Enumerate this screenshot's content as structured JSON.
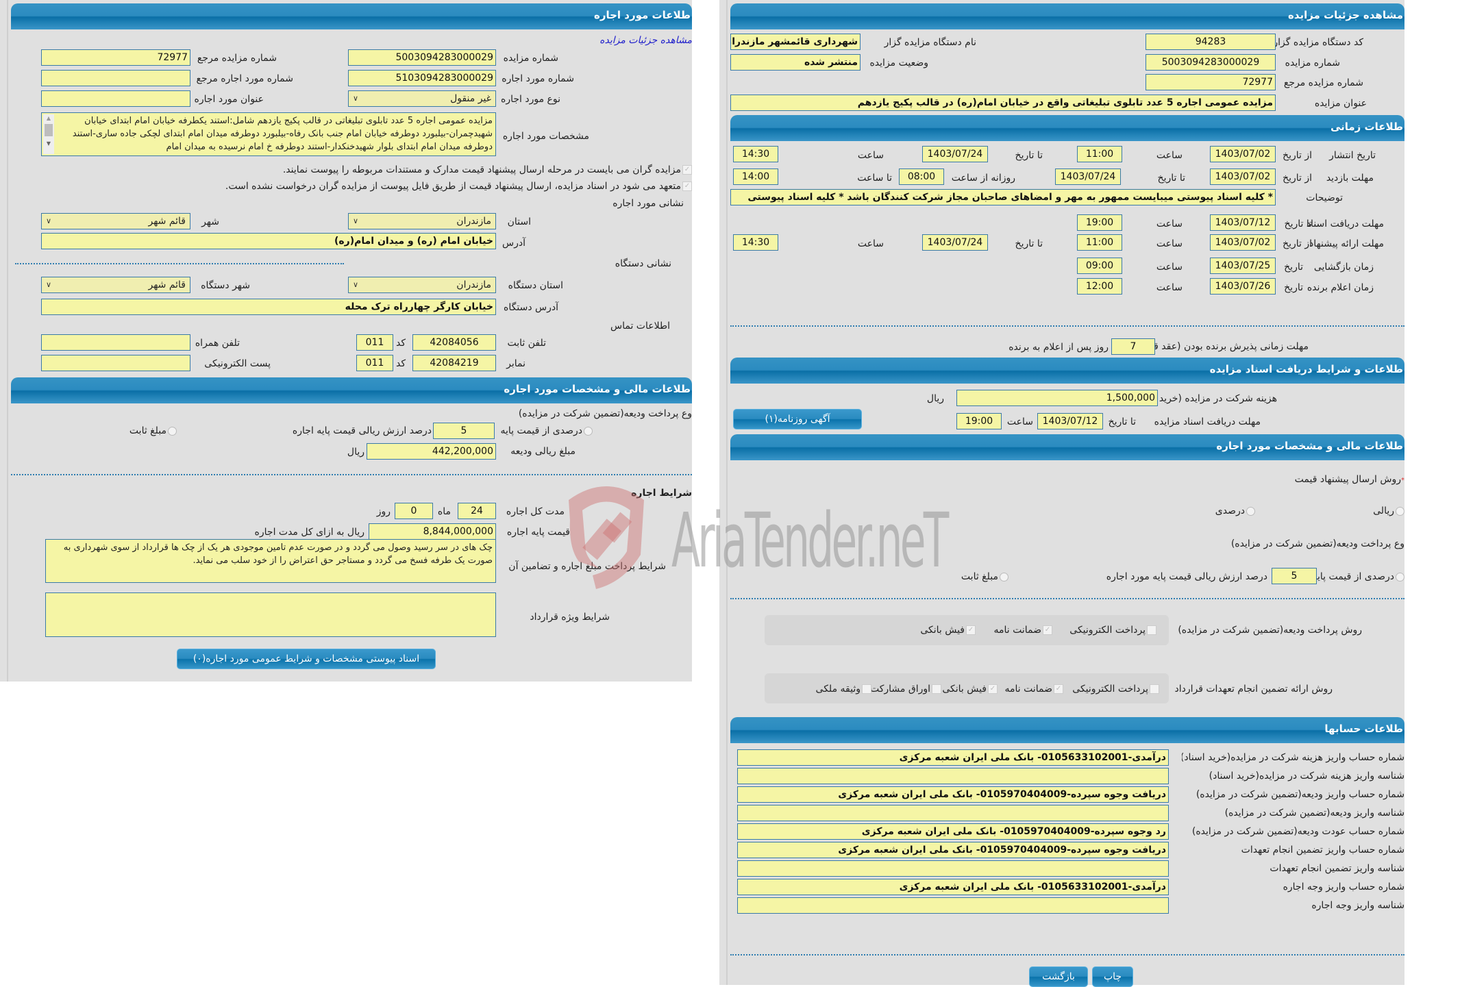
{
  "left": {
    "header": "طلاعات مورد اجاره",
    "view_details_link": "مشاهده جزئیات مزایده",
    "auction_number_label": "شماره مزایده",
    "auction_number": "5003094283000029",
    "ref_auction_number_label": "شماره مزایده مرجع",
    "ref_auction_number": "72977",
    "lease_item_number_label": "شماره مورد اجاره",
    "lease_item_number": "5103094283000029",
    "ref_lease_item_number_label": "شماره مورد اجاره مرجع",
    "ref_lease_item_number": "",
    "lease_type_label": "نوع مورد اجاره",
    "lease_type": "غیر منقول",
    "lease_title_label": "عنوان مورد اجاره",
    "lease_title": "",
    "specs_label": "مشخصات مورد اجاره",
    "specs": "مزایده عمومی اجاره 5 عدد تابلوی تبلیغاتی در قالب پکیج یازدهم شامل:استند یکطرفه خیابان امام ابتدای خیابان شهیدچمران-بیلبورد دوطرفه خیابان امام جنب بانک رفاه-بیلبورد دوطرفه میدان امام ابتدای لچکی جاده ساری-استند دوطرفه میدان امام ابتدای بلوار شهیدخنکدار-استند دوطرفه خ امام نرسیده به میدان امام",
    "check1": "مزایده گران می بایست در مرحله ارسال پیشنهاد قیمت مدارک و مستندات مربوطه را پیوست نمایند.",
    "check2": "متعهد می شود در اسناد مزایده، ارسال پیشنهاد قیمت از طریق فایل پیوست از مزایده گران درخواست نشده است.",
    "lease_address_title": "نشانی مورد اجاره",
    "province_label": "استان",
    "province": "مازندران",
    "city_label": "شهر",
    "city": "قائم شهر",
    "address_label": "آدرس",
    "address": "خیابان امام (ره) و میدان امام(ره)",
    "org_address_title": "نشانی دستگاه",
    "org_province_label": "استان دستگاه",
    "org_province": "مازندران",
    "org_city_label": "شهر دستگاه",
    "org_city": "قائم شهر",
    "org_address_label": "آدرس دستگاه",
    "org_address": "خیابان کارگر چهارراه ترک محله",
    "contact_title": "اطلاعات تماس",
    "phone_label": "تلفن ثابت",
    "phone": "42084056",
    "code_label": "کد",
    "phone_code": "011",
    "mobile_label": "تلفن همراه",
    "mobile": "",
    "fax_label": "نمابر",
    "fax": "42084219",
    "fax_code": "011",
    "email_label": "پست الکترونیکی",
    "email": "",
    "fin_header": "طلاعات مالی و مشخصات مورد اجاره",
    "deposit_type_label": "وع پرداخت ودیعه(تضمین شرکت در مزایده)",
    "percent_of_base_label": "درصدی از قیمت پایه",
    "percent_value": "5",
    "percent_suffix": "درصد ارزش ریالی قیمت پایه اجاره",
    "fixed_amount_label": "مبلغ ثابت",
    "deposit_amount_label": "مبلغ ریالی ودیعه",
    "deposit_amount": "442,200,000",
    "rial": "ریال",
    "lease_terms_title": "شرایط اجاره",
    "duration_label": "مدت کل اجاره",
    "duration_months": "24",
    "month_label": "ماه",
    "duration_days": "0",
    "day_label": "روز",
    "base_price_label": "قیمت پایه اجاره",
    "base_price": "8,844,000,000",
    "base_price_suffix": "ریال به ازای کل مدت اجاره",
    "payment_terms_label": "شرایط پرداخت مبلغ اجاره و تضامین آن",
    "payment_terms": "چک های در سر رسید وصول می گردد  و در صورت عدم تامین موجودی هر یک از چک ها قرارداد از سوی شهرداری به صورت یک طرفه فسخ می گردد و مستاجر حق اعتراض را از خود سلب می نماید.",
    "special_terms_label": "شرایط ویژه قرارداد",
    "special_terms": "",
    "attachments_button": "اسناد پیوستی مشخصات و شرایط عمومی مورد اجاره(۰)"
  },
  "right": {
    "header": "مشاهده جزئیات مزایده",
    "org_code_label": "کد دستگاه مزایده گزار",
    "org_code": "94283",
    "org_name_label": "نام دستگاه مزایده گزار",
    "org_name": "شهرداری قائمشهر مازندران",
    "auction_number_label": "شماره مزایده",
    "auction_number": "5003094283000029",
    "status_label": "وضعیت مزایده",
    "status": "منتشر شده",
    "ref_number_label": "شماره مزایده مرجع",
    "ref_number": "72977",
    "title_label": "عنوان مزایده",
    "title": "مزایده عمومی اجاره 5 عدد تابلوی تبلیغاتی واقع در خیابان امام(ره) در قالب پکیج یازدهم",
    "timing_header": "طلاعات زمانی",
    "publish_label": "تاریخ انتشار",
    "from_date_label": "از تاریخ",
    "to_date_label": "تا تاریخ",
    "date_label": "تاریخ",
    "time_label": "ساعت",
    "until_time_label": "تا ساعت",
    "daily_from_label": "روزانه از ساعت",
    "publish_from_date": "1403/07/02",
    "publish_from_time": "11:00",
    "publish_to_date": "1403/07/24",
    "publish_to_time": "14:30",
    "visit_label": "مهلت بازدید",
    "visit_from_date": "1403/07/02",
    "visit_to_date": "1403/07/24",
    "visit_daily_from": "08:00",
    "visit_daily_to": "14:00",
    "notes_label": "توضیحات",
    "notes": "*  کلیه اسناد پیوستی میبایست ممهور به مهر و امضاهای صاحبان مجاز شرکت کنندگان باشد * کلیه اسناد پیوستی",
    "doc_deadline_label": "مهلت دریافت اسناد",
    "doc_deadline_date": "1403/07/12",
    "doc_deadline_time": "19:00",
    "offer_label": "مهلت ارائه پیشنهاد",
    "offer_from_date": "1403/07/02",
    "offer_from_time": "11:00",
    "offer_to_date": "1403/07/24",
    "offer_to_time": "14:30",
    "opening_label": "زمان بازگشایی",
    "opening_date": "1403/07/25",
    "opening_time": "09:00",
    "winner_label": "زمان اعلام برنده",
    "winner_date": "1403/07/26",
    "winner_time": "12:00",
    "acceptance_label": "مهلت زمانی پذیرش برنده بودن (عقد قرارداد)",
    "acceptance_days": "7",
    "acceptance_suffix": "روز پس از اعلام به برنده",
    "docs_header": "طلاعات و شرایط دریافت اسناد مزایده",
    "fee_label": "هزینه شرکت در مزایده (خرید اسناد)",
    "fee": "1,500,000",
    "rial": "ریال",
    "docs_deadline_label": "مهلت دریافت اسناد مزایده",
    "docs_deadline_date": "1403/07/12",
    "docs_deadline_time": "19:00",
    "newspaper_button": "آگهی روزنامه(۱)",
    "fin_header": "طلاعات مالی و مشخصات مورد اجاره",
    "price_method_label": "روش ارسال پیشنهاد قیمت",
    "rial_option": "ریالی",
    "percent_option": "درصدی",
    "deposit_type_label": "وع پرداخت ودیعه(تضمین شرکت در مزایده)",
    "percent_of_base_label": "درصدی از قیمت پایه",
    "percent_value": "5",
    "percent_suffix": "درصد ارزش ریالی قیمت پایه مورد اجاره",
    "fixed_amount_label": "مبلغ ثابت",
    "deposit_method_label": "روش پرداخت ودیعه(تضمین شرکت در مزایده)",
    "deposit_methods": [
      {
        "label": "پرداخت الکترونیکی",
        "checked": false
      },
      {
        "label": "ضمانت نامه",
        "checked": true
      },
      {
        "label": "فیش بانکی",
        "checked": true
      }
    ],
    "guarantee_method_label": "روش ارائه تضمین انجام تعهدات قرارداد",
    "guarantee_methods": [
      {
        "label": "پرداخت الکترونیکی",
        "checked": false
      },
      {
        "label": "ضمانت نامه",
        "checked": true
      },
      {
        "label": "فیش بانکی",
        "checked": true
      },
      {
        "label": "اوراق مشارکت",
        "checked": false
      },
      {
        "label": "وثیقه ملکی",
        "checked": false
      }
    ],
    "accounts_header": "طلاعات حسابها",
    "accounts": [
      {
        "label": "شماره حساب واریز هزینه شرکت در مزایده(خرید اسناد)",
        "value": "درآمدی-0105633102001- بانک ملی ایران شعبه مرکزی"
      },
      {
        "label": "شناسه واریز هزینه شرکت در مزایده(خرید اسناد)",
        "value": ""
      },
      {
        "label": "شماره حساب واریز ودیعه(تضمین شرکت در مزایده)",
        "value": "دریافت وجوه سپرده-0105970404009- بانک ملی ایران شعبه مرکزی"
      },
      {
        "label": "شناسه واریز ودیعه(تضمین شرکت در مزایده)",
        "value": ""
      },
      {
        "label": "شماره حساب عودت ودیعه(تضمین شرکت در مزایده)",
        "value": "رد وجوه سپرده-0105970404009- بانک ملی ایران شعبه مرکزی"
      },
      {
        "label": "شماره حساب واریز تضمین انجام تعهدات",
        "value": "دریافت وجوه سپرده-0105970404009- بانک ملی ایران شعبه مرکزی"
      },
      {
        "label": "شناسه واریز تضمین انجام تعهدات",
        "value": ""
      },
      {
        "label": "شماره حساب واریز وجه اجاره",
        "value": "درآمدی-0105633102001- بانک ملی ایران شعبه مرکزی"
      },
      {
        "label": "شناسه واریز وجه اجاره",
        "value": ""
      }
    ],
    "print_button": "چاپ",
    "back_button": "بازگشت"
  },
  "watermark": "AriaTender.neT"
}
